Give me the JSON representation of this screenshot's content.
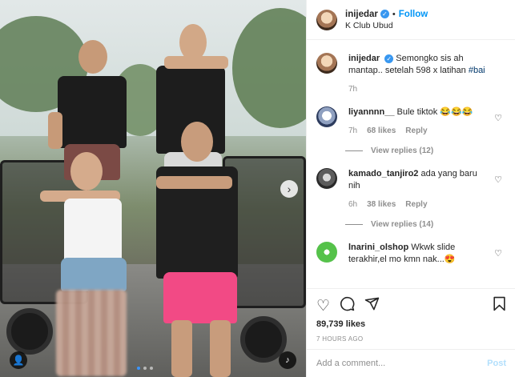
{
  "header": {
    "username": "inijedar",
    "follow_label": "Follow",
    "location": "K Club Ubud"
  },
  "caption": {
    "username": "inijedar",
    "text": "Semongko sis ah mantap.. setelah 598 x latihan",
    "hashtag": "#bai",
    "time": "7h"
  },
  "comments": [
    {
      "username": "liyannnn__",
      "text": "Bule tiktok 😂😂😂",
      "time": "7h",
      "likes": "68 likes",
      "reply_label": "Reply",
      "view_replies": "View replies (12)"
    },
    {
      "username": "kamado_tanjiro2",
      "text": "ada yang baru nih",
      "time": "6h",
      "likes": "38 likes",
      "reply_label": "Reply",
      "view_replies": "View replies (14)"
    },
    {
      "username": "lnarini_olshop",
      "text": "Wkwk slide terakhir,el mo kmn nak...😍"
    }
  ],
  "stats": {
    "likes": "89,739 likes",
    "time_ago": "7 HOURS AGO"
  },
  "add_comment": {
    "placeholder": "Add a comment...",
    "post_label": "Post"
  },
  "icons": {
    "like": "heart-icon",
    "comment": "comment-bubble-icon",
    "share": "send-icon",
    "save": "bookmark-icon",
    "next": "chevron-right-icon",
    "audio": "audio-icon",
    "tag": "user-tag-icon"
  },
  "colors": {
    "accent": "#0095f6",
    "verified": "#3897f0",
    "meta": "#8e8e8e"
  }
}
